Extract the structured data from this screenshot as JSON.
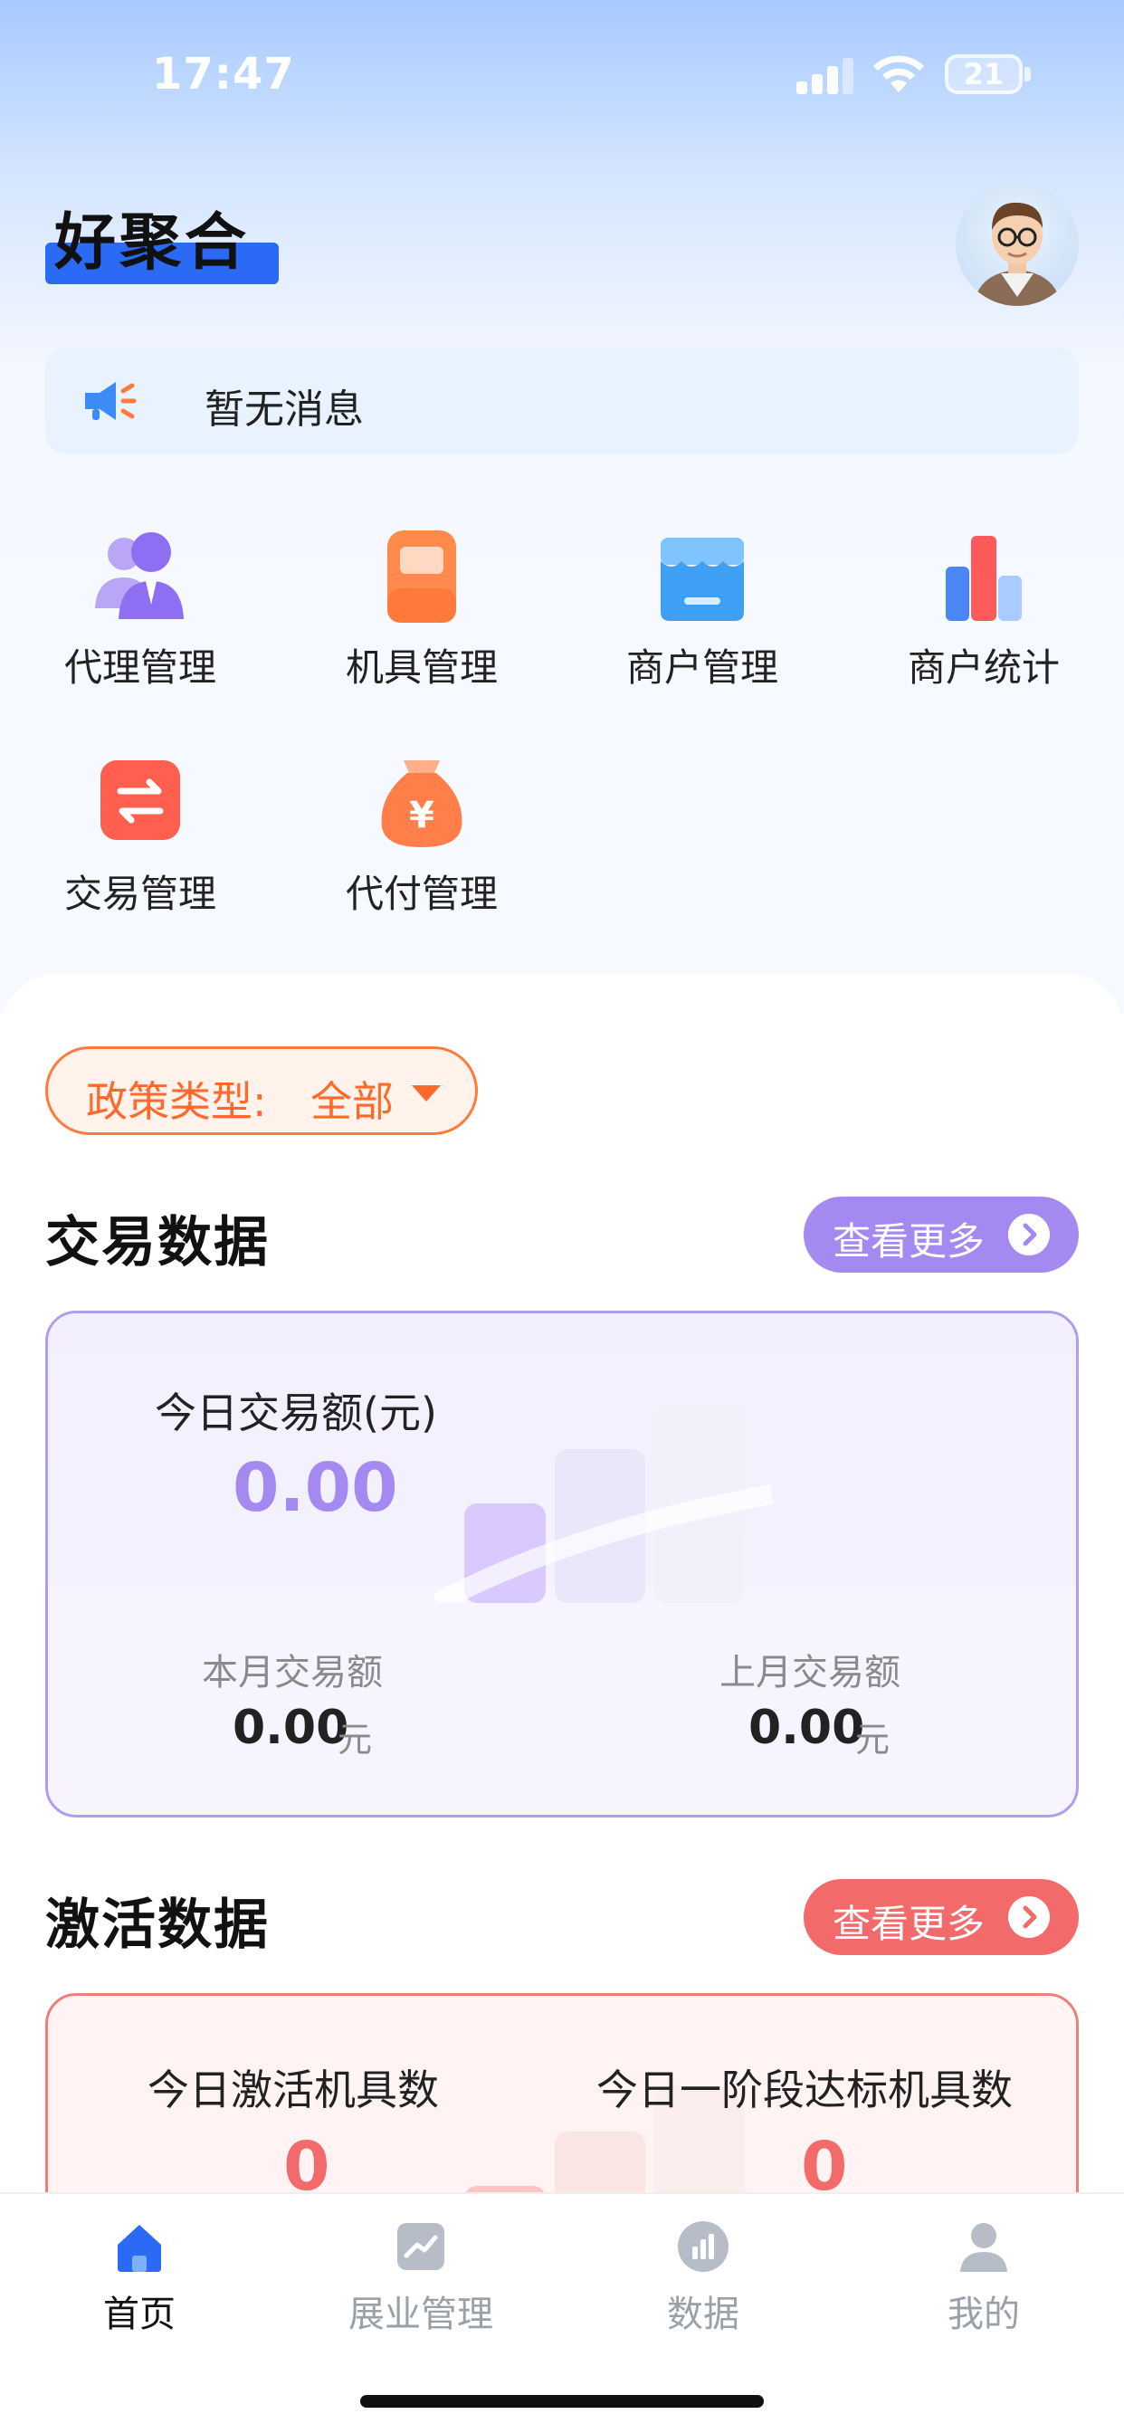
{
  "status_bar": {
    "time": "17:47",
    "battery": "21"
  },
  "header": {
    "app_title": "好聚合"
  },
  "notice": {
    "text": "暂无消息"
  },
  "menu": [
    {
      "label": "代理管理",
      "icon": "agent-icon"
    },
    {
      "label": "机具管理",
      "icon": "device-icon"
    },
    {
      "label": "商户管理",
      "icon": "store-icon"
    },
    {
      "label": "商户统计",
      "icon": "bar-chart-icon"
    },
    {
      "label": "交易管理",
      "icon": "exchange-icon"
    },
    {
      "label": "代付管理",
      "icon": "money-bag-icon"
    }
  ],
  "policy": {
    "label": "政策类型:",
    "value": "全部"
  },
  "trade": {
    "title": "交易数据",
    "more": "查看更多",
    "today_label": "今日交易额(元)",
    "today_value": "0.00",
    "month_label": "本月交易额",
    "month_value": "0.00",
    "month_unit": "元",
    "last_month_label": "上月交易额",
    "last_month_value": "0.00",
    "last_month_unit": "元"
  },
  "activation": {
    "title": "激活数据",
    "more": "查看更多",
    "today_label": "今日激活机具数",
    "today_value": "0",
    "stage_label": "今日一阶段达标机具数",
    "stage_value": "0"
  },
  "tabbar": [
    {
      "label": "首页",
      "icon": "home-icon",
      "active": true
    },
    {
      "label": "展业管理",
      "icon": "trend-icon",
      "active": false
    },
    {
      "label": "数据",
      "icon": "data-icon",
      "active": false
    },
    {
      "label": "我的",
      "icon": "user-icon",
      "active": false
    }
  ],
  "colors": {
    "accent_blue": "#2a6af5",
    "policy_orange": "#ff6a2b",
    "trade_purple": "#a48af0",
    "activation_red": "#f26a6a"
  }
}
